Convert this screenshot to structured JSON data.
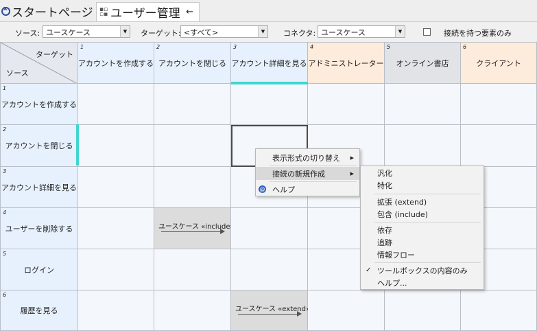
{
  "tabs": [
    {
      "label": "スタートページ"
    },
    {
      "label": "ユーザー管理",
      "pin": "←"
    }
  ],
  "toolbar": {
    "source_label": "ソース:",
    "source_value": "ユースケース",
    "target_label": "ターゲット:",
    "target_value": "<すべて>",
    "connector_label": "コネクタ:",
    "connector_value": "ユースケース",
    "only_connected_label": "接続を持つ要素のみ",
    "only_connected_checked": false
  },
  "matrix": {
    "corner_target": "ターゲット",
    "corner_source": "ソース",
    "columns": [
      {
        "num": "1",
        "label": "アカウントを作成する",
        "color": "#e7f1fd"
      },
      {
        "num": "2",
        "label": "アカウントを閉じる",
        "color": "#e7f1fd"
      },
      {
        "num": "3",
        "label": "アカウント詳細を見る",
        "color": "#e7f1fd"
      },
      {
        "num": "4",
        "label": "アドミニストレーター",
        "color": "#fdebdb"
      },
      {
        "num": "5",
        "label": "オンライン書店",
        "color": "#e1e3e7"
      },
      {
        "num": "6",
        "label": "クライアント",
        "color": "#fdebdb"
      }
    ],
    "rows": [
      {
        "num": "1",
        "label": "アカウントを作成する"
      },
      {
        "num": "2",
        "label": "アカウントを閉じる"
      },
      {
        "num": "3",
        "label": "アカウント詳細を見る"
      },
      {
        "num": "4",
        "label": "ユーザーを削除する"
      },
      {
        "num": "5",
        "label": "ログイン"
      },
      {
        "num": "6",
        "label": "履歴を見る"
      }
    ],
    "relations": {
      "r4c2": "ユースケース «include»",
      "r6c3": "ユースケース «extend»"
    }
  },
  "context_menu": {
    "items": [
      {
        "label": "表示形式の切り替え",
        "submenu": true
      },
      {
        "label": "接続の新規作成",
        "submenu": true
      },
      {
        "label": "ヘルプ",
        "icon": "help-icon"
      }
    ]
  },
  "submenu": {
    "items": [
      {
        "label": "汎化"
      },
      {
        "label": "特化"
      },
      {
        "label": "拡張 (extend)"
      },
      {
        "label": "包含 (include)"
      },
      {
        "label": "依存"
      },
      {
        "label": "追跡"
      },
      {
        "label": "情報フロー"
      },
      {
        "label": "ツールボックスの内容のみ",
        "checked": true
      },
      {
        "label": "ヘルプ..."
      }
    ]
  },
  "colors": {
    "highlight": "#3fd6d1",
    "source_header": "#e7f1fd",
    "cell": "#f4f7fb",
    "relation_cell": "#dcdcdc"
  }
}
